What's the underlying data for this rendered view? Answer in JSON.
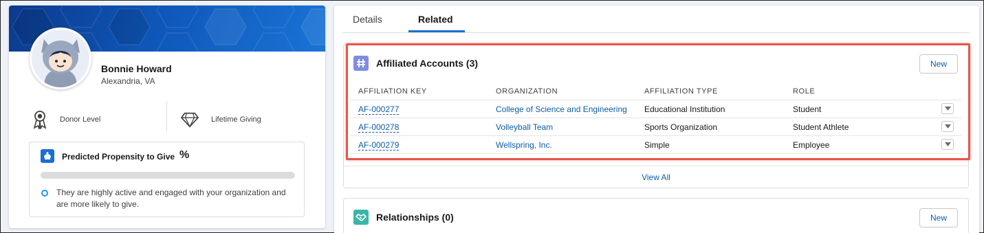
{
  "contact": {
    "name": "Bonnie Howard",
    "address": "Alexandria, VA"
  },
  "stats": {
    "donor_level_label": "Donor Level",
    "lifetime_giving_label": "Lifetime Giving"
  },
  "propensity": {
    "title": "Predicted Propensity to Give",
    "percent_symbol": "%",
    "bar_fill_fraction": 0,
    "description": "They are highly active and engaged with your organization and are more likely to give."
  },
  "tabs": [
    {
      "label": "Details",
      "active": false
    },
    {
      "label": "Related",
      "active": true
    }
  ],
  "affiliated_accounts": {
    "title": "Affiliated Accounts (3)",
    "new_label": "New",
    "columns": [
      "AFFILIATION KEY",
      "ORGANIZATION",
      "AFFILIATION TYPE",
      "ROLE"
    ],
    "rows": [
      {
        "key": "AF-000277",
        "organization": "College of Science and Engineering",
        "type": "Educational Institution",
        "role": "Student"
      },
      {
        "key": "AF-000278",
        "organization": "Volleyball Team",
        "type": "Sports Organization",
        "role": "Student Athlete"
      },
      {
        "key": "AF-000279",
        "organization": "Wellspring, Inc.",
        "type": "Simple",
        "role": "Employee"
      }
    ],
    "view_all_label": "View All",
    "icon": "affiliation-icon",
    "icon_color": "#7f8de1"
  },
  "relationships": {
    "title": "Relationships (0)",
    "new_label": "New",
    "icon": "handshake-icon",
    "icon_color": "#3bb5a6"
  },
  "colors": {
    "banner": "#0e56b8",
    "link": "#0b5cab",
    "highlight": "#e8554b"
  }
}
